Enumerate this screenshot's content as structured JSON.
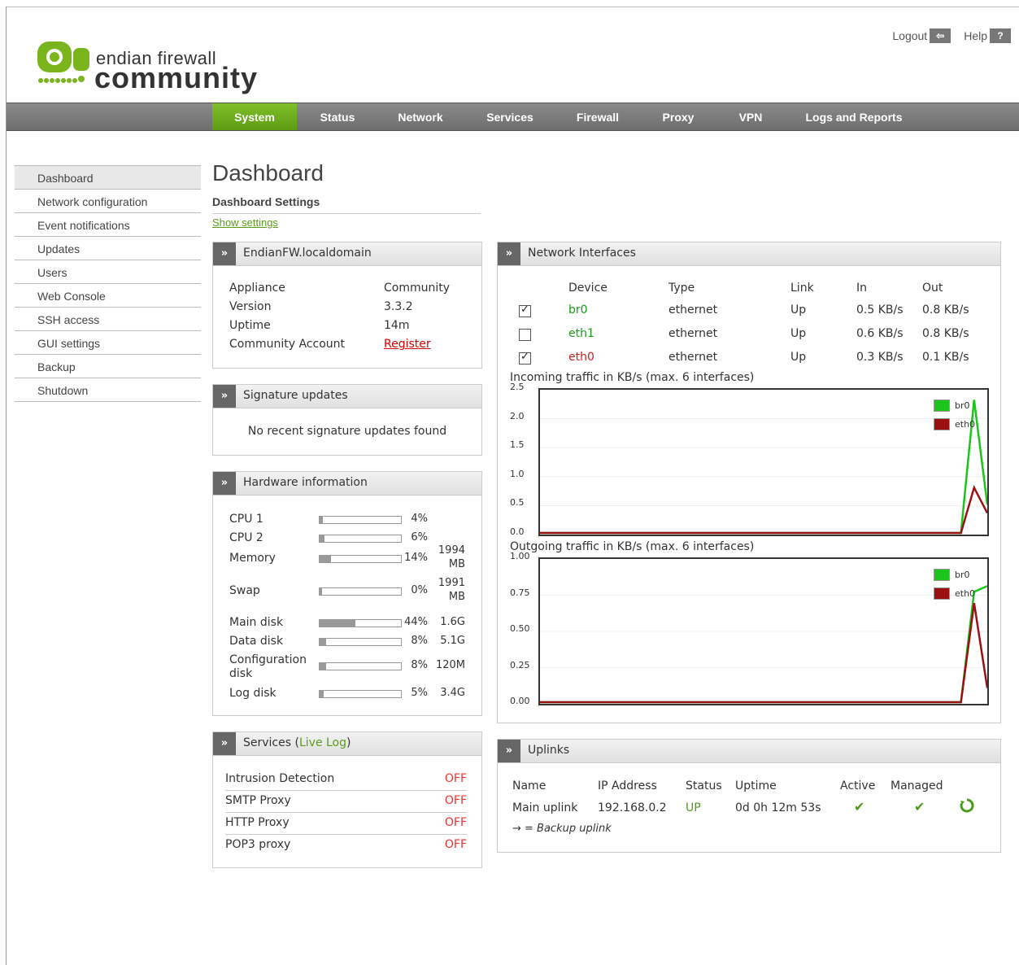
{
  "header": {
    "logo_text_top": "endian firewall",
    "logo_text_bottom": "community",
    "logout_label": "Logout",
    "help_label": "Help"
  },
  "nav": {
    "items": [
      "System",
      "Status",
      "Network",
      "Services",
      "Firewall",
      "Proxy",
      "VPN",
      "Logs and Reports"
    ],
    "active": "System"
  },
  "sidebar": {
    "items": [
      "Dashboard",
      "Network configuration",
      "Event notifications",
      "Updates",
      "Users",
      "Web Console",
      "SSH access",
      "GUI settings",
      "Backup",
      "Shutdown"
    ],
    "active": "Dashboard"
  },
  "main": {
    "title": "Dashboard",
    "settings_heading": "Dashboard Settings",
    "show_settings": "Show settings"
  },
  "host_panel": {
    "title": "EndianFW.localdomain",
    "rows": [
      {
        "label": "Appliance",
        "value": "Community"
      },
      {
        "label": "Version",
        "value": "3.3.2"
      },
      {
        "label": "Uptime",
        "value": "14m"
      },
      {
        "label": "Community Account",
        "value": "Register"
      }
    ]
  },
  "signature_panel": {
    "title": "Signature updates",
    "message": "No recent signature updates found"
  },
  "hardware_panel": {
    "title": "Hardware information",
    "rows": [
      {
        "label": "CPU 1",
        "percent": "4%",
        "fill": 0.04,
        "size": ""
      },
      {
        "label": "CPU 2",
        "percent": "6%",
        "fill": 0.06,
        "size": ""
      },
      {
        "label": "Memory",
        "percent": "14%",
        "fill": 0.14,
        "size": "1994 MB"
      },
      {
        "label": "Swap",
        "percent": "0%",
        "fill": 0.0,
        "size": "1991 MB"
      },
      {
        "label": "Main disk",
        "percent": "44%",
        "fill": 0.44,
        "size": "1.6G"
      },
      {
        "label": "Data disk",
        "percent": "8%",
        "fill": 0.08,
        "size": "5.1G"
      },
      {
        "label": "Configuration disk",
        "percent": "8%",
        "fill": 0.08,
        "size": "120M"
      },
      {
        "label": "Log disk",
        "percent": "5%",
        "fill": 0.05,
        "size": "3.4G"
      }
    ]
  },
  "services_panel": {
    "title": "Services",
    "live_log": "Live Log",
    "rows": [
      {
        "name": "Intrusion Detection",
        "status": "OFF"
      },
      {
        "name": "SMTP Proxy",
        "status": "OFF"
      },
      {
        "name": "HTTP Proxy",
        "status": "OFF"
      },
      {
        "name": "POP3 proxy",
        "status": "OFF"
      }
    ]
  },
  "interfaces_panel": {
    "title": "Network Interfaces",
    "headers": [
      "Device",
      "Type",
      "Link",
      "In",
      "Out"
    ],
    "rows": [
      {
        "checked": true,
        "device": "br0",
        "type": "ethernet",
        "link": "Up",
        "in": "0.5 KB/s",
        "out": "0.8 KB/s",
        "color": "#1a9c1a"
      },
      {
        "checked": false,
        "device": "eth1",
        "type": "ethernet",
        "link": "Up",
        "in": "0.6 KB/s",
        "out": "0.8 KB/s",
        "color": "#1a9c1a"
      },
      {
        "checked": true,
        "device": "eth0",
        "type": "ethernet",
        "link": "Up",
        "in": "0.3 KB/s",
        "out": "0.1 KB/s",
        "color": "#d02020"
      }
    ]
  },
  "chart_data": [
    {
      "type": "line",
      "title": "Incoming traffic in KB/s (max. 6 interfaces)",
      "ylim": [
        0,
        2.5
      ],
      "yticks": [
        "2.5",
        "2.0",
        "1.5",
        "1.0",
        "0.5",
        "0.0"
      ],
      "legend": "top-right",
      "series": [
        {
          "name": "br0",
          "color": "#1cc41c",
          "values": [
            0,
            0,
            0,
            0,
            0,
            0,
            0,
            0,
            0,
            0,
            0,
            0,
            0,
            0,
            0,
            0,
            0,
            0,
            0,
            0,
            0,
            0,
            0,
            0,
            0,
            0,
            0,
            0,
            0,
            0,
            0,
            0,
            0,
            2.35,
            0.5
          ]
        },
        {
          "name": "eth0",
          "color": "#9b1010",
          "values": [
            0,
            0,
            0,
            0,
            0,
            0,
            0,
            0,
            0,
            0,
            0,
            0,
            0,
            0,
            0,
            0,
            0,
            0,
            0,
            0,
            0,
            0,
            0,
            0,
            0,
            0,
            0,
            0,
            0,
            0,
            0,
            0,
            0,
            0.8,
            0.35
          ]
        }
      ]
    },
    {
      "type": "line",
      "title": "Outgoing traffic in KB/s (max. 6 interfaces)",
      "ylim": [
        0,
        1.0
      ],
      "yticks": [
        "1.00",
        "0.75",
        "0.50",
        "0.25",
        "0.00"
      ],
      "legend": "top-right",
      "series": [
        {
          "name": "br0",
          "color": "#1cc41c",
          "values": [
            0,
            0,
            0,
            0,
            0,
            0,
            0,
            0,
            0,
            0,
            0,
            0,
            0,
            0,
            0,
            0,
            0,
            0,
            0,
            0,
            0,
            0,
            0,
            0,
            0,
            0,
            0,
            0,
            0,
            0,
            0,
            0,
            0,
            0.78,
            0.82
          ]
        },
        {
          "name": "eth0",
          "color": "#9b1010",
          "values": [
            0,
            0,
            0,
            0,
            0,
            0,
            0,
            0,
            0,
            0,
            0,
            0,
            0,
            0,
            0,
            0,
            0,
            0,
            0,
            0,
            0,
            0,
            0,
            0,
            0,
            0,
            0,
            0,
            0,
            0,
            0,
            0,
            0,
            0.7,
            0.1
          ]
        }
      ]
    }
  ],
  "uplinks_panel": {
    "title": "Uplinks",
    "headers": [
      "Name",
      "IP Address",
      "Status",
      "Uptime",
      "Active",
      "Managed"
    ],
    "rows": [
      {
        "name": "Main uplink",
        "ip": "192.168.0.2",
        "status": "UP",
        "uptime": "0d 0h 12m 53s"
      }
    ],
    "backup_note": "→ = Backup uplink"
  },
  "colors": {
    "accent": "#6aab1f",
    "nav_bg": "#777777",
    "off": "#e33333"
  }
}
